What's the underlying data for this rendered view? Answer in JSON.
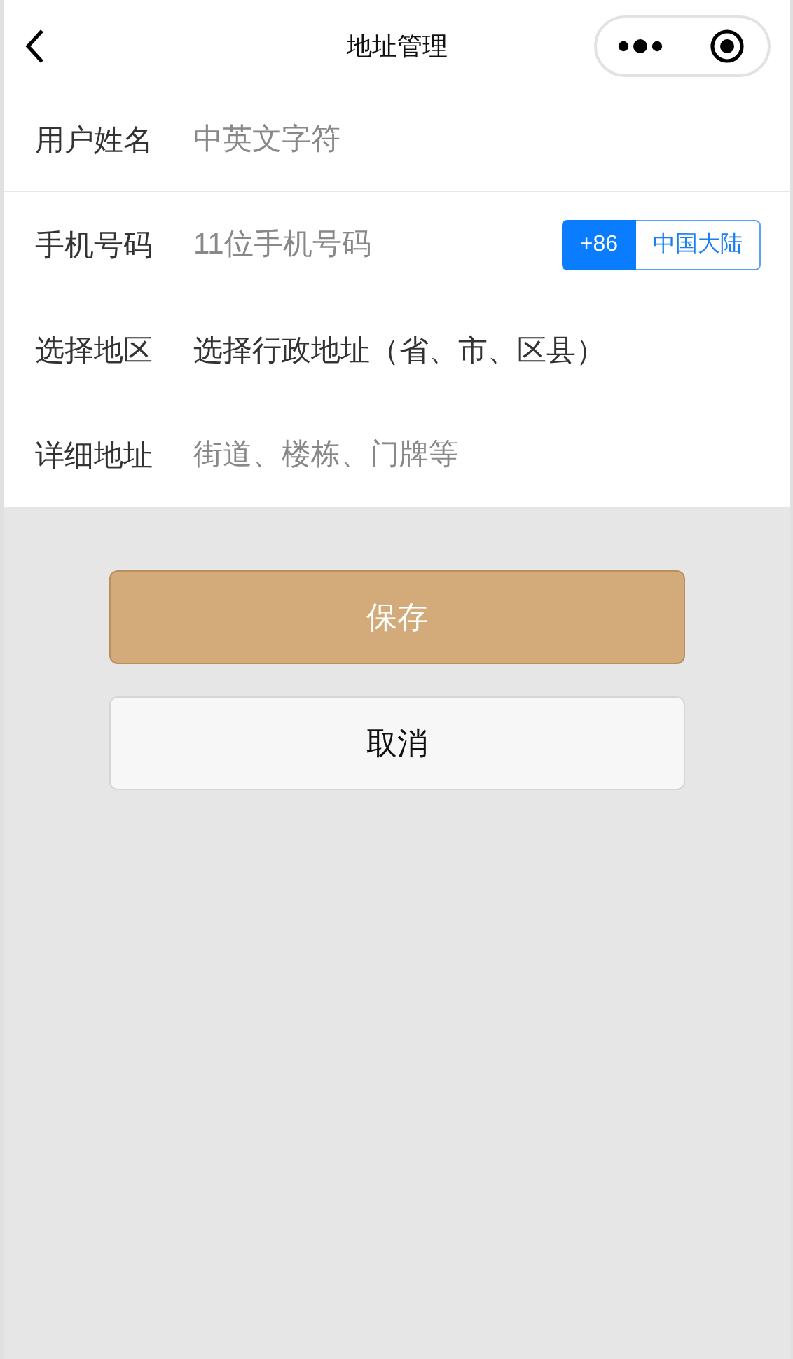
{
  "nav": {
    "title": "地址管理"
  },
  "fields": [
    {
      "kind": "input",
      "label": "用户姓名",
      "placeholder": "中英文字符"
    },
    {
      "kind": "phone",
      "label": "手机号码",
      "placeholder": "11位手机号码",
      "codes": [
        {
          "label": "+86",
          "selected": true
        },
        {
          "label": "中国大陆",
          "selected": false
        }
      ]
    },
    {
      "kind": "picker",
      "label": "选择地区",
      "value": "选择行政地址（省、市、区县）"
    },
    {
      "kind": "input",
      "label": "详细地址",
      "placeholder": "街道、楼栋、门牌等"
    }
  ],
  "buttons": [
    {
      "kind": "primary",
      "label": "保存"
    },
    {
      "kind": "default",
      "label": "取消"
    }
  ]
}
